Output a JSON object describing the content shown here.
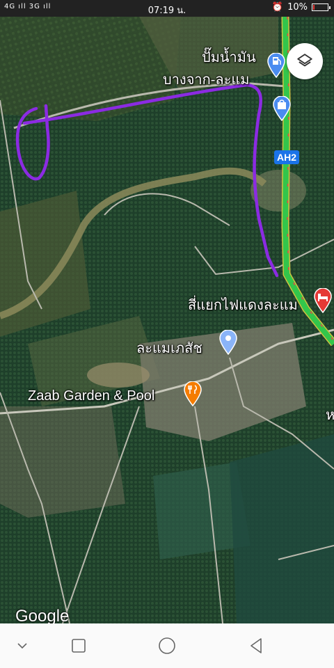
{
  "status_bar": {
    "signal": "4G ıll 3G ıll",
    "time": "07:19 น.",
    "battery": "10%",
    "battery_level": 0.1
  },
  "map": {
    "labels": {
      "gas_station_line1": "ปั๊มน้ำมัน",
      "gas_station_line2": "บางจาก-ละแม",
      "intersection": "สี่แยกไฟแดงละแม",
      "pharmacy": "ละแมเภสัช",
      "restaurant": "Zaab Garden & Pool",
      "road_shield": "AH2"
    },
    "attribution": "Google",
    "route_color": "#8b2be2",
    "highway_color": "#33c64b",
    "icons": {
      "layers": "layers-icon",
      "gas": "gas-pump-icon",
      "shopping": "shopping-bag-icon",
      "hotel": "bed-icon",
      "pharmacy": "pin-icon",
      "restaurant": "fork-knife-icon"
    }
  },
  "nav_bar": {
    "back": "chevron-down-icon",
    "recents": "square-icon",
    "home": "circle-icon",
    "triangle": "triangle-back-icon"
  }
}
